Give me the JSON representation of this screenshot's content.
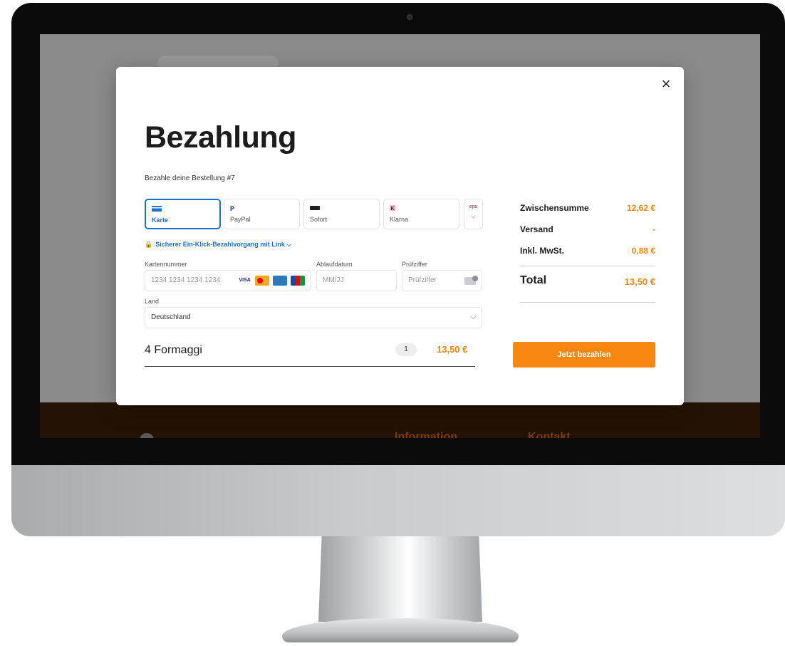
{
  "modal": {
    "title": "Bezahlung",
    "subtitle": "Bezahle deine Bestellung #7",
    "close_icon": "×",
    "payment_methods": [
      {
        "label": "Karte",
        "icon": "card-icon",
        "active": true
      },
      {
        "label": "PayPal",
        "icon": "paypal-icon",
        "active": false
      },
      {
        "label": "Sofort",
        "icon": "sofort-icon",
        "active": false
      },
      {
        "label": "Klarna",
        "icon": "klarna-icon",
        "active": false
      }
    ],
    "more_methods": {
      "label": "eps",
      "chevron": "⌵"
    },
    "link_text": "Sicherer Ein-Klick-Bezahlvorgang mit Link ⌵",
    "card_number": {
      "label": "Kartennummer",
      "placeholder": "1234 1234 1234 1234",
      "brands": [
        "VISA"
      ]
    },
    "expiry": {
      "label": "Ablaufdatum",
      "placeholder": "MM/JJ"
    },
    "cvc": {
      "label": "Prüfziffer",
      "placeholder": "Prüfziffer"
    },
    "country": {
      "label": "Land",
      "value": "Deutschland",
      "chevron": "⌵"
    },
    "item": {
      "name": "4 Formaggi",
      "qty": "1",
      "price": "13,50 €"
    },
    "summary": {
      "subtotal_label": "Zwischensumme",
      "subtotal_value": "12,62 €",
      "shipping_label": "Versand",
      "shipping_value": "-",
      "tax_label": "Inkl. MwSt.",
      "tax_value": "0,88 €",
      "total_label": "Total",
      "total_value": "13,50 €"
    },
    "pay_button": "Jetzt bezahlen"
  },
  "footer": {
    "col1": "Information",
    "col2": "Kontakt"
  },
  "colors": {
    "accent": "#f7870f",
    "link": "#1b6fd6"
  }
}
